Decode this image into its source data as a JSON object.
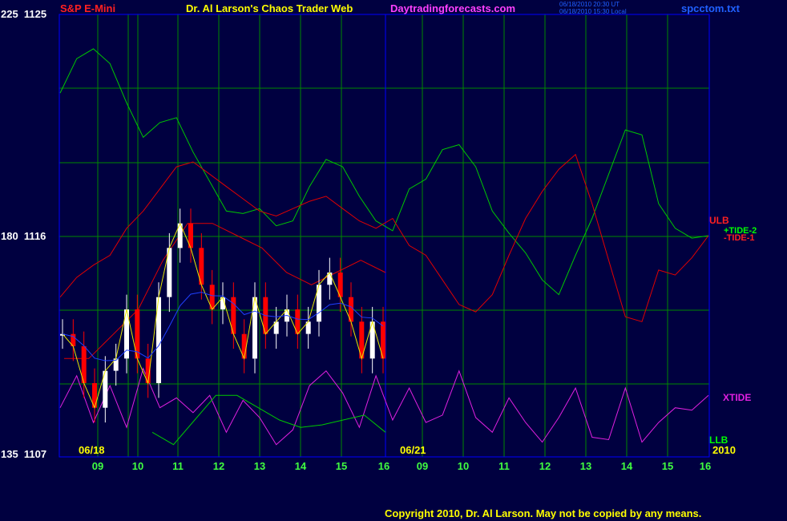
{
  "header": {
    "symbol": "S&P E-Mini",
    "title": "Dr. Al Larson's Chaos Trader Web",
    "site": "Daytradingforecasts.com",
    "stamp_ut": "06/18/2010 20:30 UT",
    "stamp_local": "06/18/2010 15:30 Local",
    "file": "spcctom.txt"
  },
  "y_axis": {
    "top": "225  1125",
    "mid": "180  1116",
    "bot": "135  1107"
  },
  "dates": {
    "d1": "06/18",
    "d2": "06/21",
    "year": "2010"
  },
  "hours": [
    "09",
    "10",
    "11",
    "12",
    "13",
    "14",
    "15",
    "16",
    "09",
    "10",
    "11",
    "12",
    "13",
    "14",
    "15",
    "16"
  ],
  "labels": {
    "ulb": "ULB",
    "tide2": "+TIDE-2",
    "tide1": "-TIDE-1",
    "xtide": "XTIDE",
    "llb": "LLB"
  },
  "copyright": "Copyright 2010, Dr. Al Larson. May not be copied by any means.",
  "colors": {
    "background": "#000040",
    "grid": "#008800",
    "frame": "#0000ff",
    "green": "#00c800",
    "red": "#e00000",
    "magenta": "#e020e0",
    "price": "#ffffff",
    "price_down": "#ff0000",
    "avg_yellow": "#e6e600",
    "avg_blue": "#2040ff",
    "axis_text": "#ffffff",
    "hour_text": "#40ff40",
    "date_text": "#ffff00"
  },
  "chart_data": {
    "type": "line",
    "title": "Dr. Al Larson's Chaos Trader Web",
    "ylim": [
      1107,
      1125
    ],
    "x_labels": [
      "09",
      "10",
      "11",
      "12",
      "13",
      "14",
      "15",
      "16",
      "09",
      "10",
      "11",
      "12",
      "13",
      "14",
      "15",
      "16"
    ],
    "series": [
      {
        "name": "+TIDE-2",
        "color": "#00c800",
        "values": [
          1121.8,
          1123.2,
          1123.6,
          1123.0,
          1121.4,
          1120.0,
          1120.6,
          1120.8,
          1119.4,
          1118.2,
          1117.0,
          1116.9,
          1117.1,
          1116.4,
          1116.6,
          1118.0,
          1119.1,
          1118.8,
          1117.6,
          1116.6,
          1116.2,
          1117.9,
          1118.3,
          1119.5,
          1119.7,
          1118.8,
          1117.0,
          1116.1,
          1115.3,
          1114.2,
          1113.6,
          1115.2,
          1116.7,
          1118.5,
          1120.3,
          1120.1,
          1117.3,
          1116.3,
          1115.9,
          1116.0
        ]
      },
      {
        "name": "-TIDE-1",
        "color": "#e00000",
        "values": [
          1113.5,
          1114.3,
          1114.8,
          1115.2,
          1116.3,
          1117.0,
          1117.9,
          1118.8,
          1119.0,
          1118.5,
          1118.0,
          1117.5,
          1117.0,
          1116.8,
          1117.1,
          1117.4,
          1117.6,
          1117.1,
          1116.6,
          1116.3,
          1116.7,
          1115.6,
          1115.2,
          1114.2,
          1113.2,
          1112.9,
          1113.6,
          1115.2,
          1116.7,
          1117.8,
          1118.7,
          1119.3,
          1117.3,
          1115.0,
          1112.7,
          1112.5,
          1114.6,
          1114.4,
          1115.1,
          1116.0
        ]
      },
      {
        "name": "XTIDE",
        "color": "#e020e0",
        "values": [
          1109.0,
          1110.3,
          1108.4,
          1109.9,
          1108.2,
          1110.6,
          1109.0,
          1109.4,
          1108.8,
          1109.5,
          1108.0,
          1109.3,
          1108.6,
          1107.5,
          1108.1,
          1109.9,
          1110.5,
          1109.6,
          1108.2,
          1110.3,
          1108.5,
          1109.8,
          1108.4,
          1108.7,
          1110.5,
          1108.6,
          1108.0,
          1109.4,
          1108.4,
          1107.6,
          1108.6,
          1109.8,
          1107.8,
          1107.7,
          1109.8,
          1107.6,
          1108.4,
          1109.0,
          1108.9,
          1109.5
        ]
      },
      {
        "name": "ULB",
        "color": "#e00000",
        "values": [
          1111.0,
          1111.0,
          1112.0,
          1113.0,
          1115.0,
          1116.5,
          1116.5,
          1116.0,
          1115.5,
          1114.5,
          1114.0,
          1114.5,
          1115.0,
          1114.5
        ]
      },
      {
        "name": "LLB",
        "color": "#00c800",
        "values": [
          1108.0,
          1107.5,
          1108.5,
          1109.5,
          1109.5,
          1109.0,
          1108.5,
          1108.2,
          1108.3,
          1108.5,
          1108.7,
          1108.0
        ]
      },
      {
        "name": "Price",
        "color": "#ffffff",
        "values": [
          1112.0,
          1111.5,
          1110.0,
          1109.0,
          1110.5,
          1111.0,
          1113.0,
          1111.0,
          1110.0,
          1113.5,
          1115.5,
          1116.5,
          1115.5,
          1114.0,
          1113.0,
          1113.5,
          1112.0,
          1111.0,
          1113.5,
          1112.0,
          1112.5,
          1113.0,
          1112.0,
          1112.5,
          1114.0,
          1114.5,
          1113.5,
          1112.5,
          1111.0,
          1112.5,
          1111.0
        ]
      }
    ]
  }
}
